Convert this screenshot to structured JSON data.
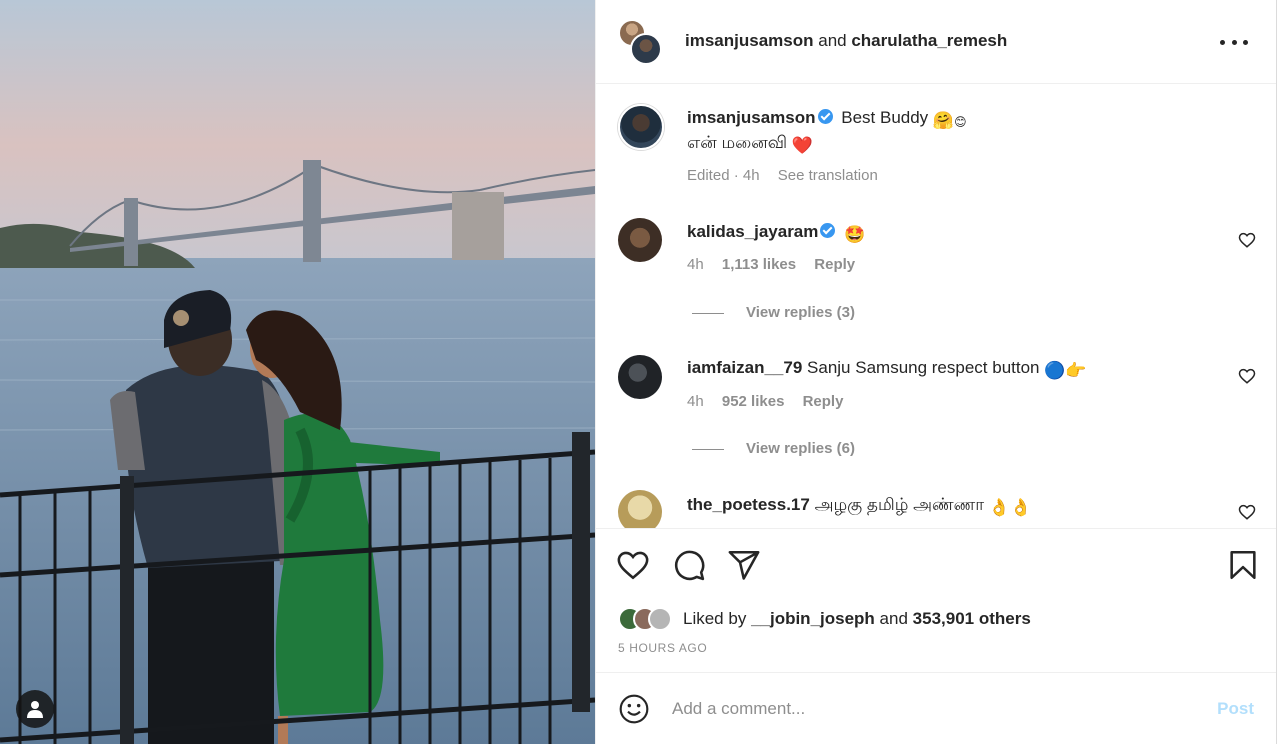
{
  "header": {
    "user1": "imsanjusamson",
    "joiner": "and",
    "user2": "charulatha_remesh",
    "more_icon": "more-horizontal-icon"
  },
  "caption": {
    "username": "imsanjusamson",
    "text_line1": "Best Buddy",
    "emoji1": "🤗",
    "emoji1b": "😊",
    "text_line2": "என் மனைவி",
    "emoji2": "❤️",
    "edited": "Edited · 4h",
    "see_translation": "See translation"
  },
  "comments": [
    {
      "username": "kalidas_jayaram",
      "verified": true,
      "text": "",
      "emoji": "🤩",
      "time": "4h",
      "likes": "1,113 likes",
      "reply": "Reply",
      "view_replies": "View replies (3)"
    },
    {
      "username": "iamfaizan__79",
      "verified": false,
      "text": "Sanju Samsung respect button",
      "emoji": "🔵👉",
      "time": "4h",
      "likes": "952 likes",
      "reply": "Reply",
      "view_replies": "View replies (6)"
    },
    {
      "username": "the_poetess.17",
      "verified": false,
      "text": "அழகு தமிழ் அண்ணா",
      "emoji": "👌👌"
    }
  ],
  "actions": {
    "like_icon": "heart-icon",
    "comment_icon": "comment-icon",
    "share_icon": "send-icon",
    "save_icon": "bookmark-icon",
    "liked_by_prefix": "Liked by",
    "liked_by_user": "__jobin_joseph",
    "liked_by_suffix": "and",
    "liked_by_count": "353,901 others",
    "time_ago": "5 hours ago"
  },
  "add_comment": {
    "placeholder": "Add a comment...",
    "post_label": "Post",
    "emoji_icon": "smiley-icon"
  },
  "colors": {
    "verified": "#3897f0",
    "post_disabled": "#b2dffc",
    "muted": "#8e8e8e",
    "text": "#262626"
  }
}
